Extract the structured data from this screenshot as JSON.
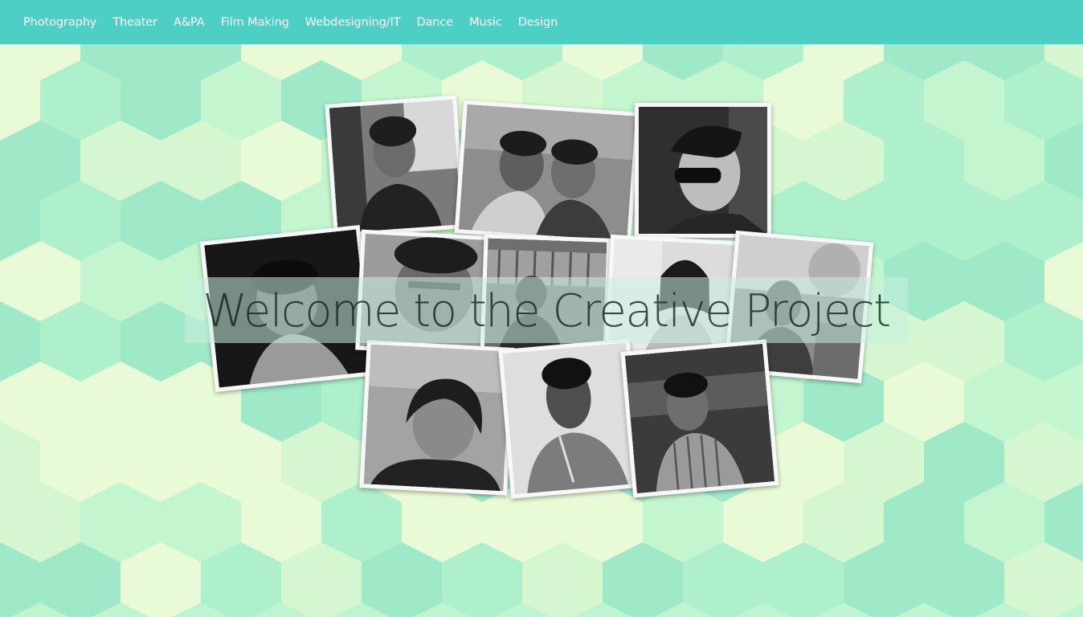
{
  "nav": {
    "items": [
      {
        "label": "Photography"
      },
      {
        "label": "Theater"
      },
      {
        "label": "A&PA"
      },
      {
        "label": "Film Making"
      },
      {
        "label": "Webdesigning/IT"
      },
      {
        "label": "Dance"
      },
      {
        "label": "Music"
      },
      {
        "label": "Design"
      }
    ]
  },
  "hero": {
    "title": "Welcome to the Creative Project"
  },
  "colors": {
    "navbar": "#4ecfc6",
    "nav_text": "#ffffff",
    "pattern_light": "#e9fbd6",
    "pattern_mid": "#c3f5cf",
    "pattern_dark": "#9fe9c9",
    "photo_border": "#f8f8f8"
  }
}
